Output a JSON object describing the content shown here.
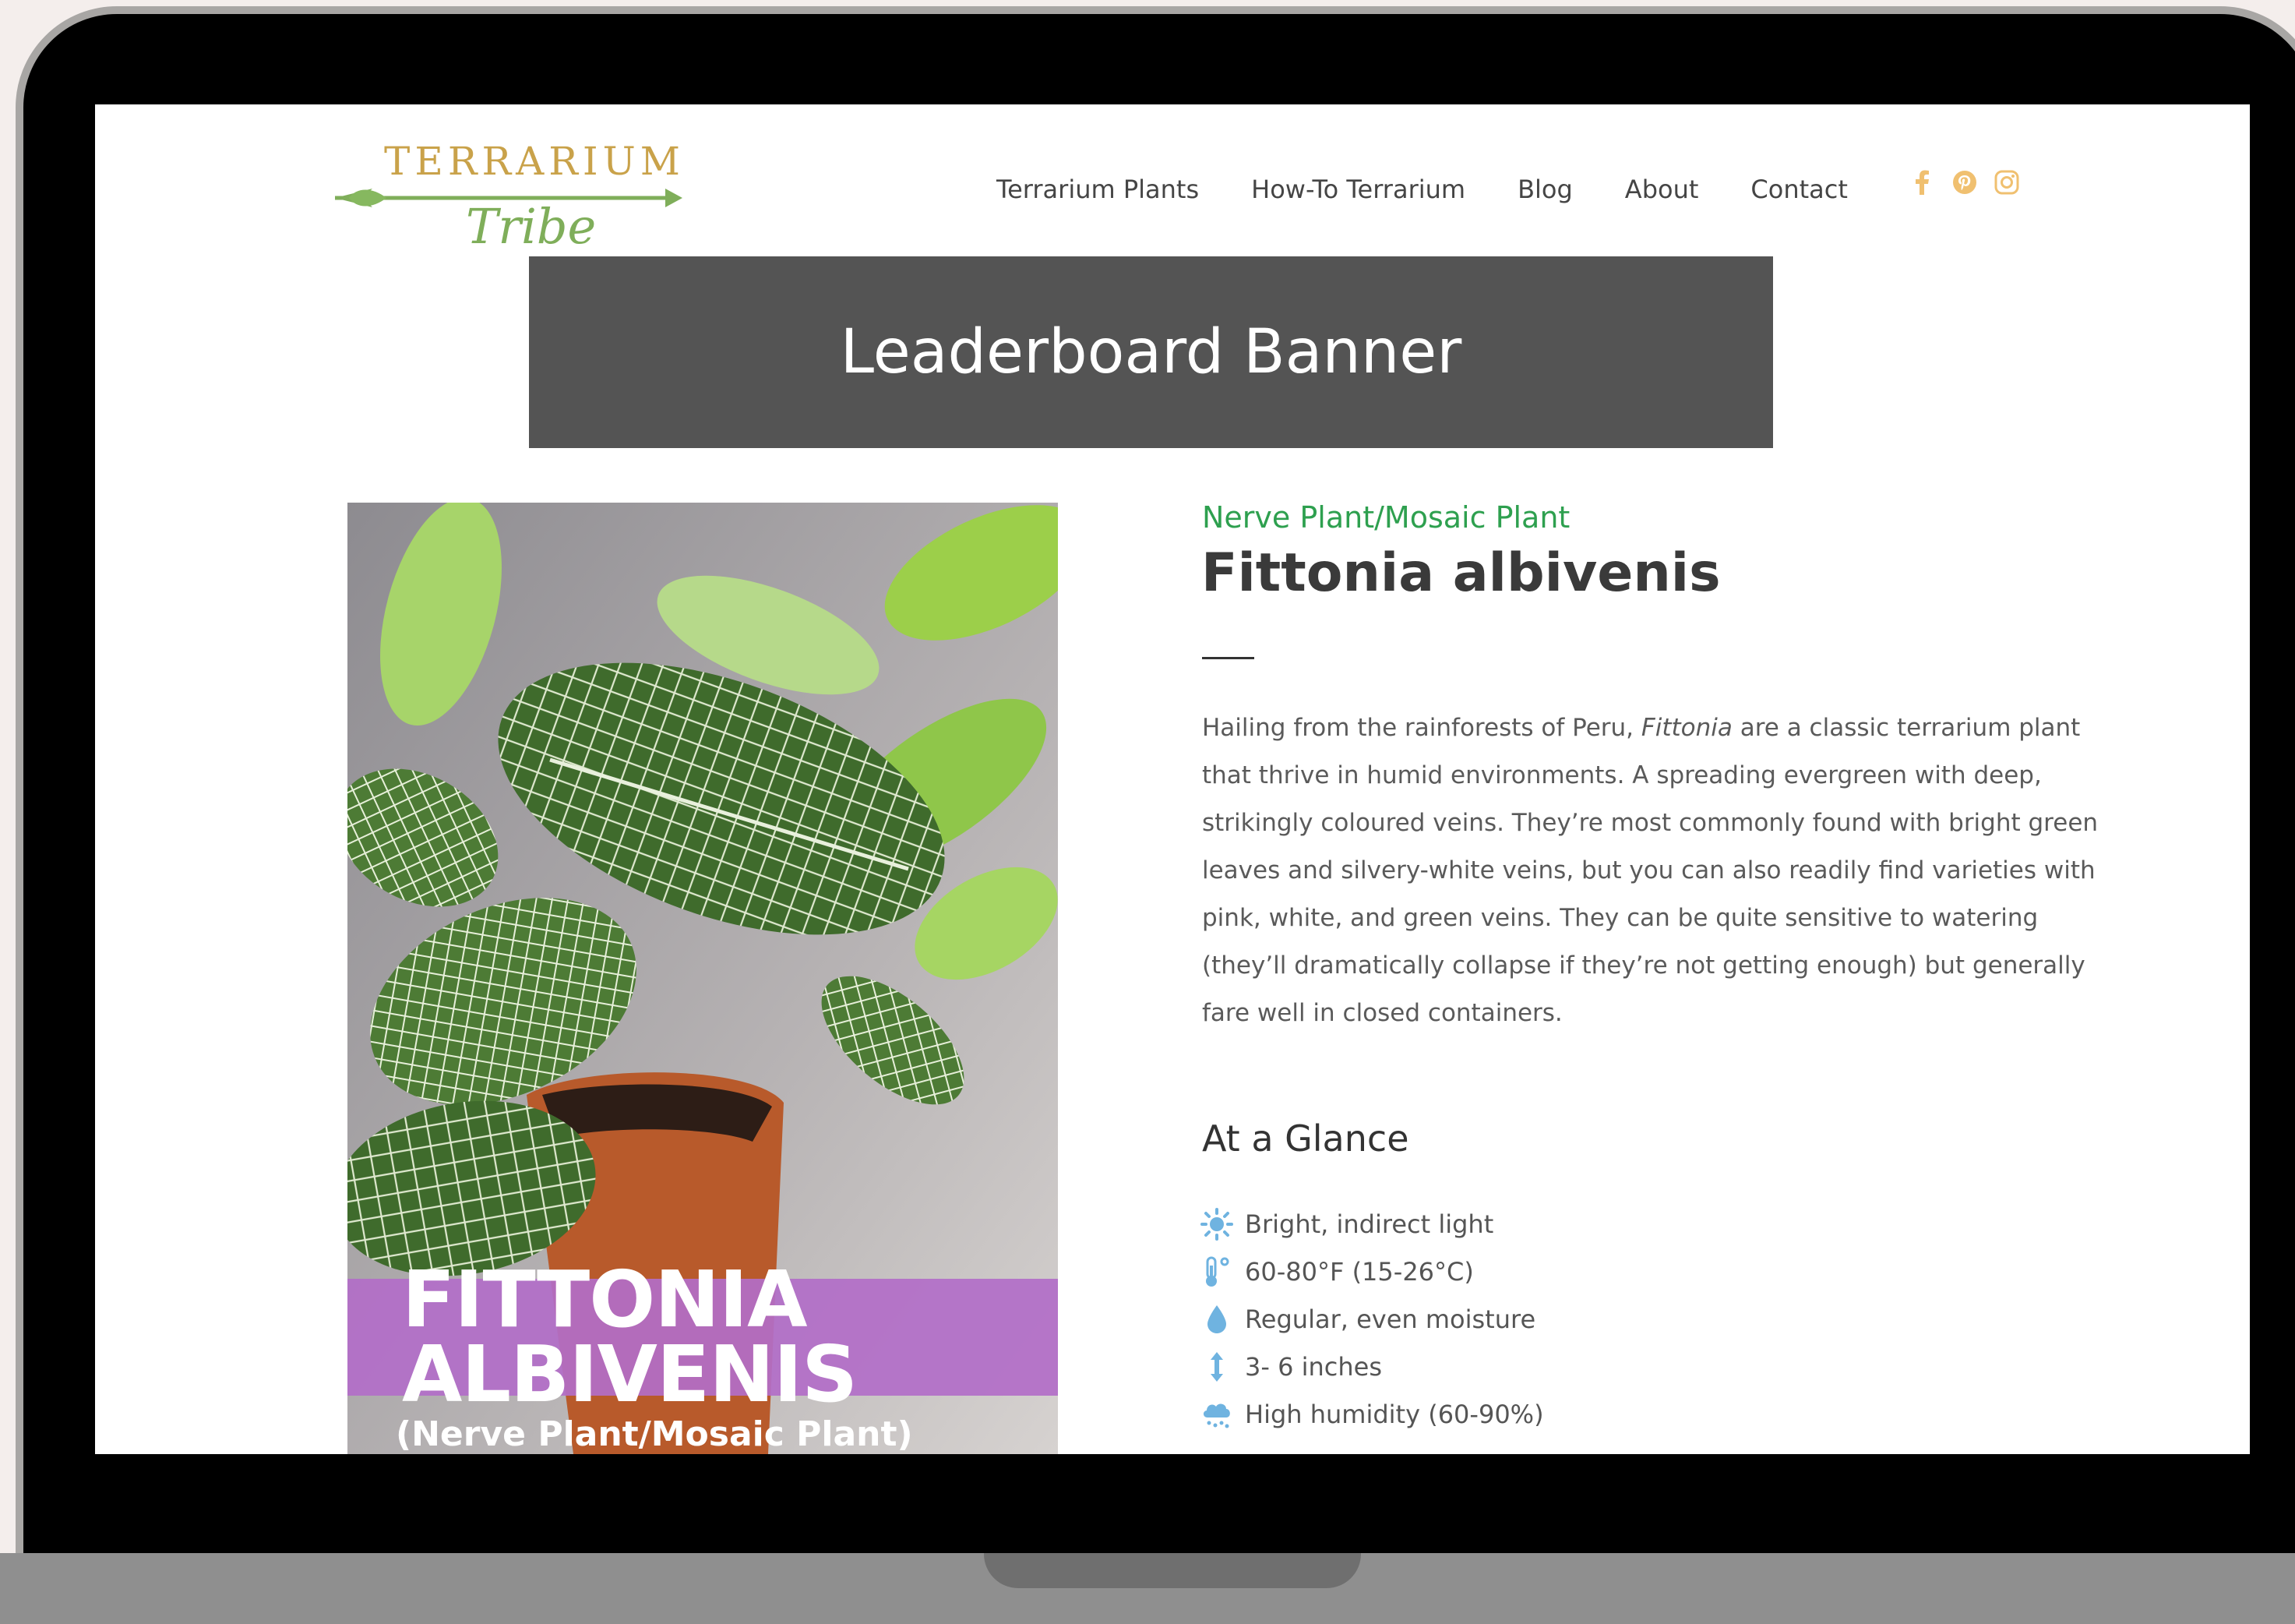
{
  "site": {
    "logo_top": "TERRARIUM",
    "logo_bottom": "Tribe"
  },
  "nav": {
    "items": [
      "Terrarium Plants",
      "How-To Terrarium",
      "Blog",
      "About",
      "Contact"
    ]
  },
  "social": {
    "icons": [
      "facebook-icon",
      "pinterest-icon",
      "instagram-icon"
    ],
    "color": "#f0c070"
  },
  "banner": {
    "label": "Leaderboard Banner"
  },
  "photo": {
    "title_line1": "FITTONIA",
    "title_line2": "ALBIVENIS",
    "subtitle": "(Nerve Plant/Mosaic Plant)"
  },
  "plant": {
    "common_name": "Nerve Plant/Mosaic Plant",
    "scientific_name": "Fittonia albivenis",
    "description_before": "Hailing from the rainforests of Peru, ",
    "description_italic": "Fittonia",
    "description_after": " are a classic terrarium plant that thrive in humid environments. A spreading evergreen with deep, strikingly coloured veins. They’re most commonly found with bright green leaves and silvery-white veins, but you can also readily find varieties with pink, white, and green veins. They can be quite sensitive to watering (they’ll dramatically collapse if they’re not getting enough) but generally fare well in closed containers."
  },
  "glance": {
    "title": "At a Glance",
    "items": [
      {
        "icon": "sun-icon",
        "text": "Bright, indirect light"
      },
      {
        "icon": "thermometer-icon",
        "text": "60-80°F (15-26°C)"
      },
      {
        "icon": "water-drop-icon",
        "text": "Regular, even moisture"
      },
      {
        "icon": "height-arrow-icon",
        "text": "3- 6 inches"
      },
      {
        "icon": "rain-cloud-icon",
        "text": "High humidity (60-90%)"
      }
    ]
  },
  "colors": {
    "accent_green": "#2ea04f",
    "icon_blue": "#6fb3e0",
    "banner_bg": "#545454"
  }
}
